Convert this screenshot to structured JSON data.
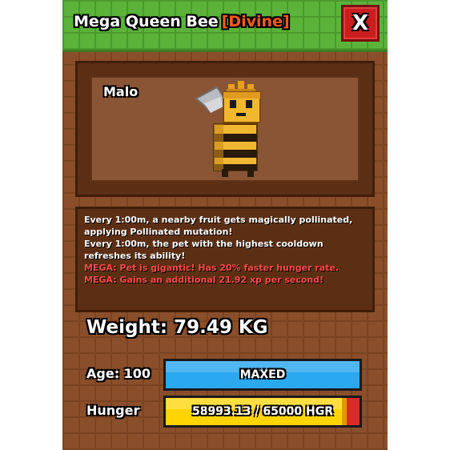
{
  "window": {
    "title": "Mega Queen Bee",
    "rarity": "[Divine]",
    "rarity_color": "#ff5a1f",
    "close_label": "X"
  },
  "pet": {
    "name": "Malo",
    "icon": "queen-bee-icon"
  },
  "description": [
    {
      "text": "Every 1:00m, a nearby fruit gets magically pollinated,",
      "type": "normal"
    },
    {
      "text": "applying Pollinated mutation!",
      "type": "normal"
    },
    {
      "text": "Every 1:00m, the pet with the highest cooldown",
      "type": "normal"
    },
    {
      "text": "refreshes its ability!",
      "type": "normal"
    },
    {
      "text": "MEGA: Pet is gigantic! Has 20% faster hunger rate.",
      "type": "mega"
    },
    {
      "text": "MEGA: Gains an additional 21.92 xp per second!",
      "type": "mega"
    }
  ],
  "stats": {
    "weight_label": "Weight: 79.49 KG",
    "age_label": "Age: 100",
    "age_bar_text": "MAXED",
    "hunger_label": "Hunger",
    "hunger_bar_text": "58993.13 / 65000 HGR",
    "hunger_current": 58993.13,
    "hunger_max": 65000
  },
  "colors": {
    "titlebar": "#5bb33a",
    "panel": "#8a4f2a",
    "age_bar": "#2aa8f0",
    "hunger_fill": "#ffd400",
    "hunger_empty": "#d92b2b",
    "mega_text": "#ff4a4a"
  }
}
